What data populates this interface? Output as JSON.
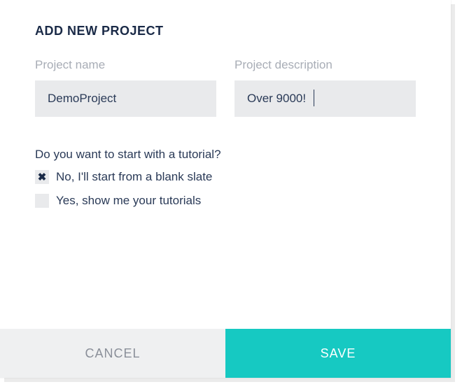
{
  "title": "ADD NEW PROJECT",
  "fields": {
    "name": {
      "label": "Project name",
      "value": "DemoProject"
    },
    "description": {
      "label": "Project description",
      "value": "Over 9000!"
    }
  },
  "tutorial": {
    "question": "Do you want to start with a tutorial?",
    "option_no": "No, I'll start from a blank slate",
    "option_yes": "Yes, show me your tutorials",
    "selected": "no"
  },
  "buttons": {
    "cancel": "CANCEL",
    "save": "SAVE"
  }
}
